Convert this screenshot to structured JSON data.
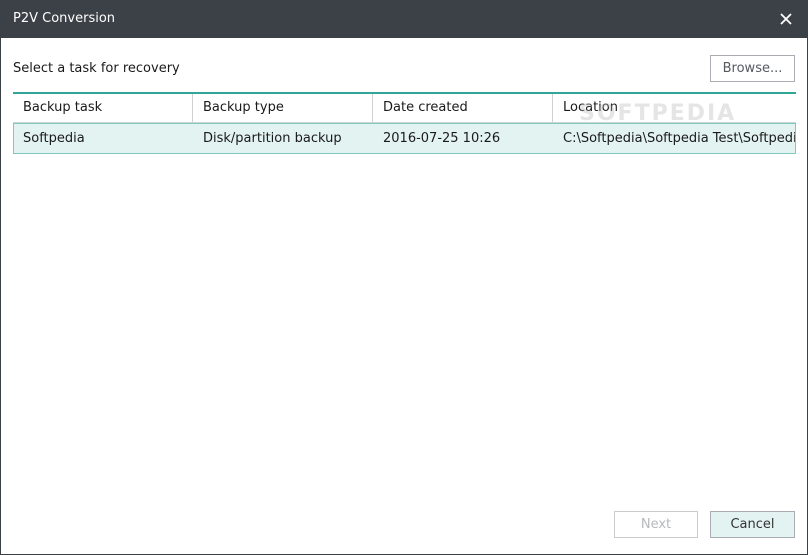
{
  "window": {
    "title": "P2V Conversion"
  },
  "main": {
    "prompt": "Select a task for recovery",
    "browse_label": "Browse..."
  },
  "table": {
    "columns": [
      "Backup task",
      "Backup type",
      "Date created",
      "Location"
    ],
    "rows": [
      {
        "task": "Softpedia",
        "type": "Disk/partition backup",
        "date": "2016-07-25 10:26",
        "location": "C:\\Softpedia\\Softpedia Test\\Softpedia"
      }
    ]
  },
  "footer": {
    "next_label": "Next",
    "cancel_label": "Cancel"
  },
  "watermark": "SOFTPEDIA",
  "colors": {
    "titlebar": "#3c4047",
    "accent": "#2fa697",
    "selected_row": "#e3f3f1"
  },
  "icons": {
    "close": "close-icon"
  }
}
